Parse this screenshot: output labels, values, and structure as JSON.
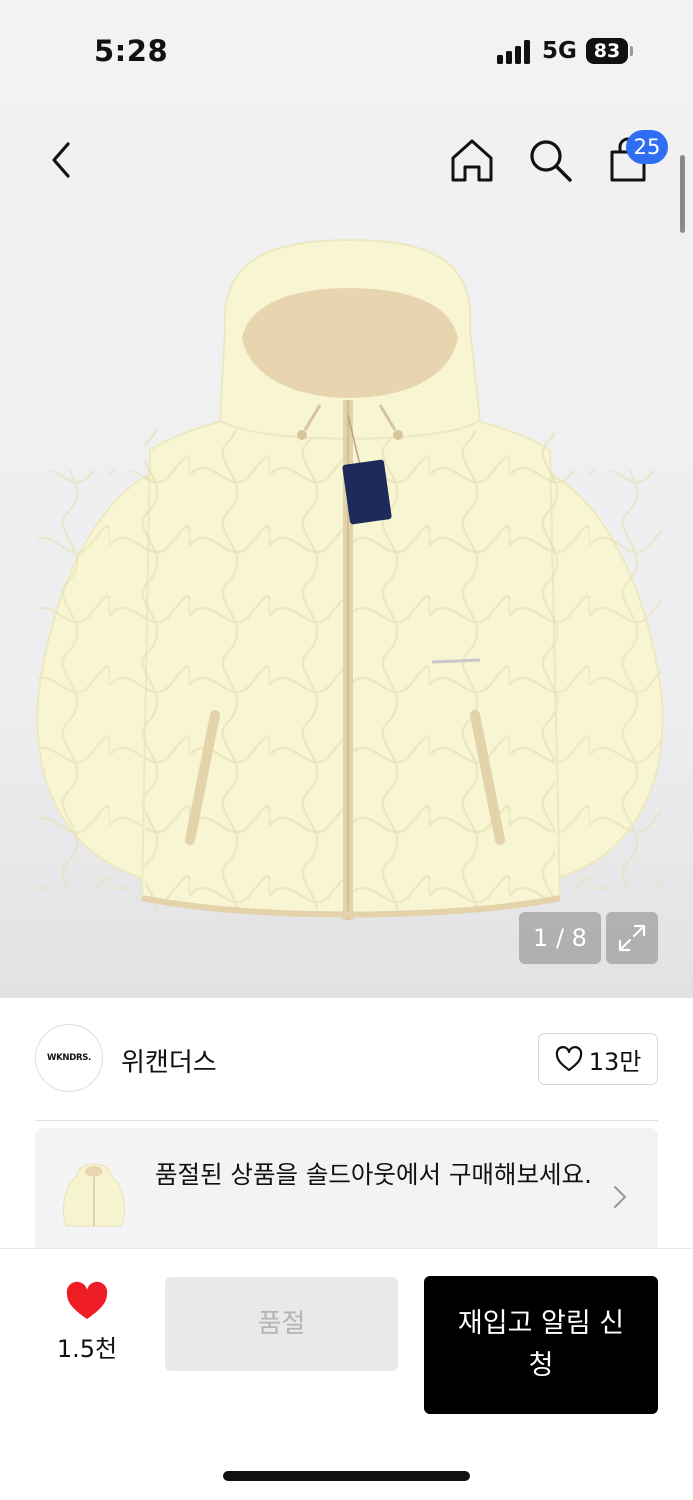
{
  "status_bar": {
    "time": "5:28",
    "network": "5G",
    "battery": "83"
  },
  "nav": {
    "back_icon": "chevron-left-icon",
    "home_icon": "home-icon",
    "search_icon": "search-icon",
    "cart_icon": "shopping-bag-icon",
    "cart_count": "25"
  },
  "gallery": {
    "counter": "1 / 8",
    "expand_icon": "expand-icon"
  },
  "brand": {
    "logo_text": "WKNDRS.",
    "name": "위캔더스",
    "likes": "13만"
  },
  "soldout_banner": {
    "text": "품절된 상품을 솔드아웃에서 구매해보세요."
  },
  "bottom_bar": {
    "wish_count": "1.5천",
    "soldout_label": "품절",
    "restock_label": "재입고 알림 신청"
  },
  "colors": {
    "accent_blue": "#2f6ef3",
    "heart_red": "#ee1c25",
    "primary_button": "#000000",
    "jacket": "#f6f4cf",
    "lining": "#e8d5b0"
  }
}
